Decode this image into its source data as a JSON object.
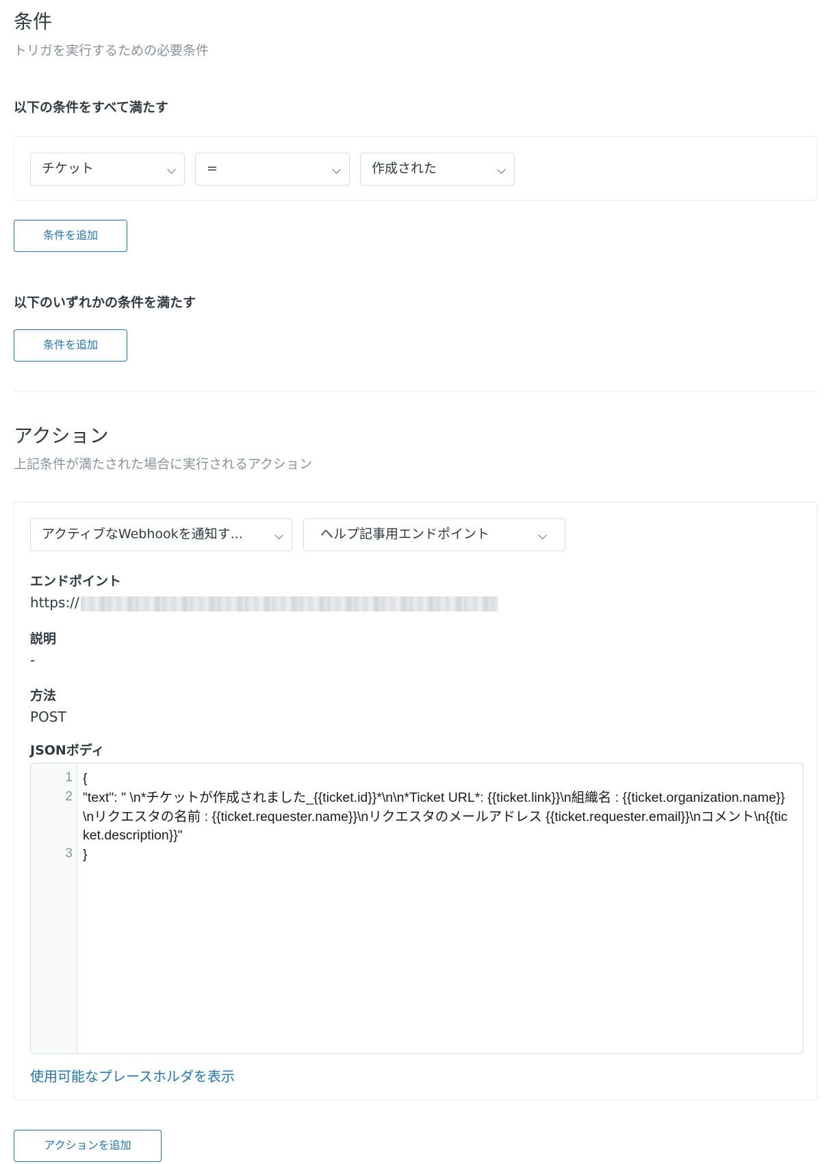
{
  "conditions": {
    "title": "条件",
    "subtitle": "トリガを実行するための必要条件",
    "all_label": "以下の条件をすべて満たす",
    "all_row": {
      "field": "チケット",
      "operator": "=",
      "value": "作成された"
    },
    "add_all_button": "条件を追加",
    "any_label": "以下のいずれかの条件を満たす",
    "add_any_button": "条件を追加"
  },
  "actions": {
    "title": "アクション",
    "subtitle": "上記条件が満たされた場合に実行されるアクション",
    "action_select": "アクティブなWebhookを通知す...",
    "webhook_select": "ヘルプ記事用エンドポイント",
    "endpoint_label": "エンドポイント",
    "endpoint_value": "https://",
    "description_label": "説明",
    "description_value": "-",
    "method_label": "方法",
    "method_value": "POST",
    "json_label": "JSONボディ",
    "json_lines": [
      {
        "num": "1",
        "text": "{"
      },
      {
        "num": "2",
        "text": "\"text\": \" \\n*チケットが作成されました_{{ticket.id}}*\\n\\n*Ticket URL*: {{ticket.link}}\\n組織名 : {{ticket.organization.name}}\\nリクエスタの名前 : {{ticket.requester.name}}\\nリクエスタのメールアドレス {{ticket.requester.email}}\\nコメント\\n{{ticket.description}}\""
      },
      {
        "num": "3",
        "text": "}"
      }
    ],
    "placeholders_link": "使用可能なプレースホルダを表示",
    "add_action_button": "アクションを追加"
  },
  "colors": {
    "accent": "#1f73b7",
    "muted_text": "#87929d",
    "border": "#d8dcde"
  },
  "icons": [
    "chevron-down-icon"
  ]
}
